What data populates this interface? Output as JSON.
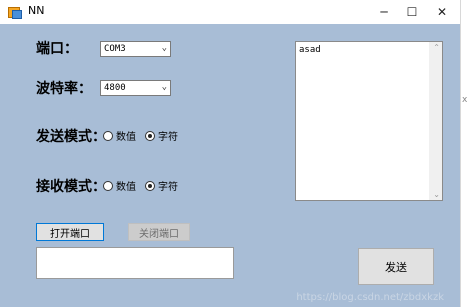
{
  "window": {
    "title": "NN",
    "controls": {
      "minimize": "─",
      "maximize": "☐",
      "close": "✕"
    }
  },
  "form": {
    "port_label": "端口：",
    "port_value": "COM3",
    "baud_label": "波特率：",
    "baud_value": "4800",
    "send_mode_label": "发送模式：",
    "send_mode_options": [
      "数值",
      "字符"
    ],
    "send_mode_selected": "字符",
    "recv_mode_label": "接收模式：",
    "recv_mode_options": [
      "数值",
      "字符"
    ],
    "recv_mode_selected": "字符",
    "receive_text": "asad",
    "send_text": "",
    "open_button": "打开端口",
    "close_button": "关闭端口",
    "send_button": "发送"
  },
  "edge_glyph": "x",
  "watermark": "https://blog.csdn.net/zbdxkzk",
  "colors": {
    "client_bg": "#a8bdd6",
    "button_focus_border": "#0078d7"
  }
}
